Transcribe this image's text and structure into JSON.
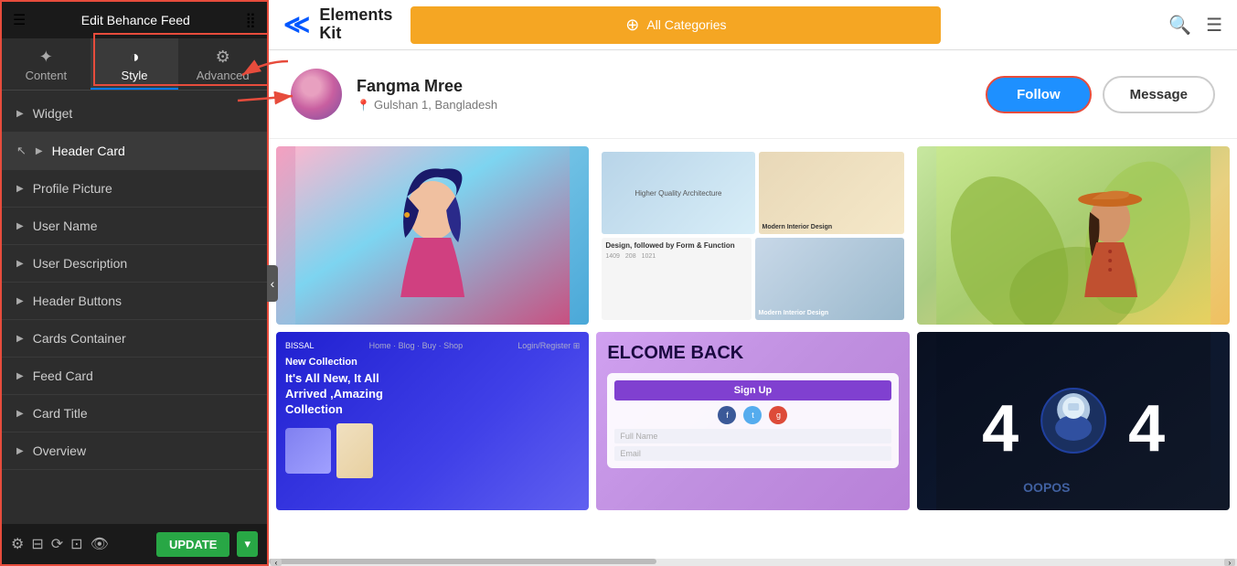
{
  "sidebar": {
    "title": "Edit Behance Feed",
    "tabs": [
      {
        "id": "content",
        "label": "Content",
        "icon": "✦"
      },
      {
        "id": "style",
        "label": "Style",
        "icon": "◑",
        "active": true
      },
      {
        "id": "advanced",
        "label": "Advanced",
        "icon": "⚙"
      }
    ],
    "items": [
      {
        "id": "widget",
        "label": "Widget"
      },
      {
        "id": "header-card",
        "label": "Header Card",
        "highlighted": true
      },
      {
        "id": "profile-picture",
        "label": "Profile Picture"
      },
      {
        "id": "user-name",
        "label": "User Name"
      },
      {
        "id": "user-description",
        "label": "User Description"
      },
      {
        "id": "header-buttons",
        "label": "Header Buttons"
      },
      {
        "id": "cards-container",
        "label": "Cards Container"
      },
      {
        "id": "feed-card",
        "label": "Feed Card"
      },
      {
        "id": "card-title",
        "label": "Card Title"
      },
      {
        "id": "overview",
        "label": "Overview"
      }
    ],
    "update_btn": "UPDATE"
  },
  "topnav": {
    "logo_brand": "Elements",
    "logo_sub": "Kit",
    "categories_btn": "All Categories",
    "search_placeholder": "Search"
  },
  "profile": {
    "name": "Fangma Mree",
    "location": "Gulshan 1, Bangladesh",
    "follow_btn": "Follow",
    "message_btn": "Message"
  },
  "cards": [
    {
      "id": "woman-illustration",
      "type": "illustration"
    },
    {
      "id": "architecture",
      "type": "architecture",
      "label1": "Higher Quality Architecture",
      "label2": "Modern Interior Design"
    },
    {
      "id": "woman-hat",
      "type": "illustration-hat"
    },
    {
      "id": "bissal",
      "type": "website",
      "brand": "BISSAL",
      "tagline": "New Collection",
      "title": "It's All New, It All Arrived, Amazing Collection"
    },
    {
      "id": "welcome-back",
      "type": "signup",
      "heading": "ELCOME BACK",
      "btn": "Sign Up"
    },
    {
      "id": "error-404",
      "type": "error",
      "text": "4●4"
    }
  ],
  "icons": {
    "hamburger": "☰",
    "grid": "⣿",
    "location_pin": "📍",
    "search": "🔍",
    "menu": "☰",
    "plus_circle": "⊕",
    "chevron_down": "▾",
    "arrow_left": "‹",
    "gear": "⚙",
    "layers": "⊟",
    "history": "⟳",
    "responsive": "⊡",
    "eye": "👁"
  },
  "colors": {
    "accent_blue": "#1e90ff",
    "accent_orange": "#f5a623",
    "accent_green": "#28a745",
    "sidebar_bg": "#2d2d2d",
    "red": "#e74c3c"
  }
}
